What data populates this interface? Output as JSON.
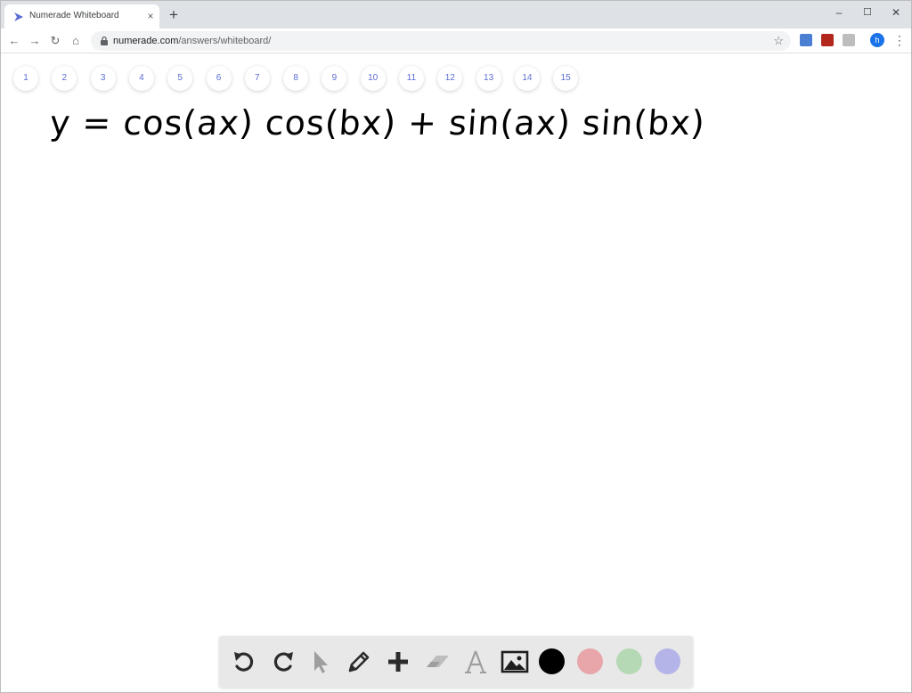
{
  "browser": {
    "tab_title": "Numerade Whiteboard",
    "tab_close": "×",
    "new_tab": "+",
    "url_host": "numerade.com",
    "url_path": "/answers/whiteboard/",
    "profile_initial": "h",
    "window_controls": {
      "minimize": "–",
      "maximize": "☐",
      "close": "✕"
    },
    "nav": {
      "back": "←",
      "forward": "→",
      "reload": "↻",
      "home": "⌂"
    },
    "star": "☆",
    "menu": "⋮"
  },
  "page_tabs": [
    "1",
    "2",
    "3",
    "4",
    "5",
    "6",
    "7",
    "8",
    "9",
    "10",
    "11",
    "12",
    "13",
    "14",
    "15"
  ],
  "canvas": {
    "text": "y = cos(ax) cos(bx) + sin(ax) sin(bx)"
  },
  "toolbar": {
    "tools": [
      "undo-icon",
      "redo-icon",
      "pointer-icon",
      "pencil-icon",
      "plus-icon",
      "eraser-icon",
      "text-icon",
      "image-icon"
    ],
    "colors": [
      "#000000",
      "#e8a5aa",
      "#b4d9b4",
      "#b4b4e8"
    ],
    "accent": "#5b6cd3"
  }
}
